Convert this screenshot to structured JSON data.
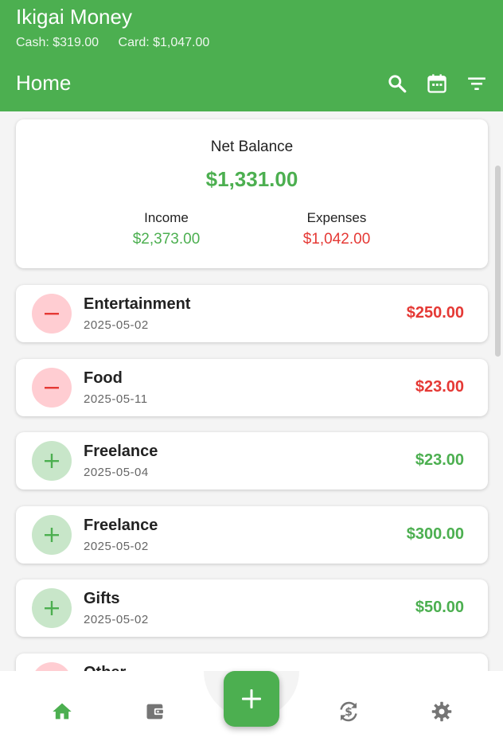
{
  "app": {
    "title": "Ikigai Money",
    "cash": "Cash: $319.00",
    "card": "Card: $1,047.00",
    "page_title": "Home"
  },
  "toolbar": {
    "icons": [
      "search-icon",
      "calendar-icon",
      "filter-icon"
    ]
  },
  "summary": {
    "label": "Net Balance",
    "net": "$1,331.00",
    "income_label": "Income",
    "income": "$2,373.00",
    "expenses_label": "Expenses",
    "expenses": "$1,042.00"
  },
  "transactions": [
    {
      "category": "Entertainment",
      "date": "2025-05-02",
      "amount": "$250.00",
      "type": "expense"
    },
    {
      "category": "Food",
      "date": "2025-05-11",
      "amount": "$23.00",
      "type": "expense"
    },
    {
      "category": "Freelance",
      "date": "2025-05-04",
      "amount": "$23.00",
      "type": "income"
    },
    {
      "category": "Freelance",
      "date": "2025-05-02",
      "amount": "$300.00",
      "type": "income"
    },
    {
      "category": "Gifts",
      "date": "2025-05-02",
      "amount": "$50.00",
      "type": "income"
    },
    {
      "category": "Other",
      "date": "",
      "amount": "",
      "type": "expense"
    }
  ],
  "bottom_nav": {
    "items": [
      "home-icon",
      "wallet-icon",
      "add-icon",
      "exchange-icon",
      "settings-icon"
    ],
    "active": "home-icon"
  },
  "colors": {
    "primary": "#4caf50",
    "expense": "#e53935",
    "expense_bg": "#ffcdd2",
    "income_bg": "#c8e6c9",
    "inactive_icon": "#757575"
  }
}
